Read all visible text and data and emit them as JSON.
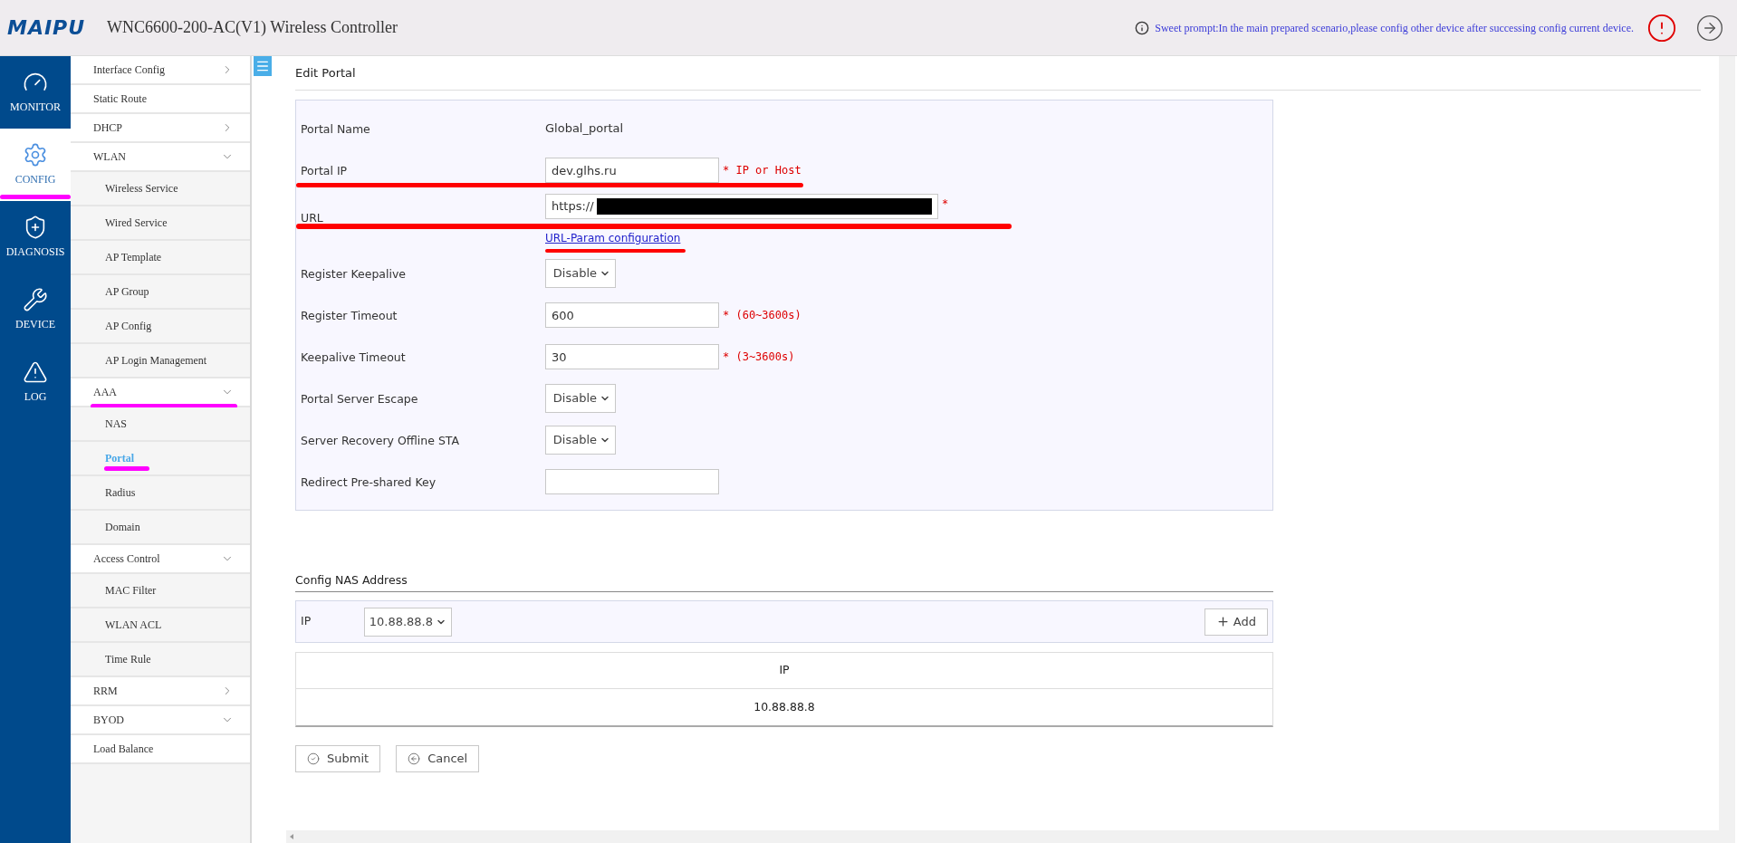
{
  "header": {
    "logo": "MAIPU",
    "title": "WNC6600-200-AC(V1) Wireless Controller",
    "prompt": "Sweet prompt:In the main prepared scenario,please config other device after successing config current device."
  },
  "nav": [
    {
      "kind": "gauge",
      "label": "MONITOR",
      "selected": false
    },
    {
      "kind": "gear",
      "label": "CONFIG",
      "selected": true
    },
    {
      "kind": "shield",
      "label": "DIAGNOSIS",
      "selected": false
    },
    {
      "kind": "wrench",
      "label": "DEVICE",
      "selected": false
    },
    {
      "kind": "alert",
      "label": "LOG",
      "selected": false
    }
  ],
  "menu": [
    {
      "label": "Interface Config",
      "expanded": false
    },
    {
      "label": "Static Route"
    },
    {
      "label": "DHCP",
      "expanded": false
    },
    {
      "label": "WLAN",
      "expanded": true,
      "children": [
        {
          "label": "Wireless Service",
          "selected": false
        },
        {
          "label": "Wired Service",
          "selected": false
        },
        {
          "label": "AP Template",
          "selected": false
        },
        {
          "label": "AP Group",
          "selected": false
        },
        {
          "label": "AP Config",
          "selected": false
        },
        {
          "label": "AP Login Management",
          "selected": false
        }
      ]
    },
    {
      "label": "AAA",
      "expanded": true,
      "children": [
        {
          "label": "NAS",
          "selected": false
        },
        {
          "label": "Portal",
          "selected": true
        },
        {
          "label": "Radius",
          "selected": false
        },
        {
          "label": "Domain",
          "selected": false
        }
      ]
    },
    {
      "label": "Access Control",
      "expanded": true,
      "children": [
        {
          "label": "MAC Filter",
          "selected": false
        },
        {
          "label": "WLAN ACL",
          "selected": false
        },
        {
          "label": "Time Rule",
          "selected": false
        }
      ]
    },
    {
      "label": "RRM",
      "expanded": false
    },
    {
      "label": "BYOD",
      "expanded": true
    },
    {
      "label": "Load Balance"
    }
  ],
  "page_title": "Edit Portal",
  "form": [
    {
      "kind": "text",
      "label": "Portal Name",
      "value": "Global_portal"
    },
    {
      "kind": "input",
      "label": "Portal IP",
      "value": "dev.glhs.ru",
      "hint": "* IP or Host"
    },
    {
      "kind": "url",
      "label": "URL",
      "value": "https://",
      "hint": "*",
      "link": "URL-Param configuration"
    },
    {
      "kind": "select",
      "label": "Register Keepalive",
      "value": "Disable"
    },
    {
      "kind": "input",
      "label": "Register Timeout",
      "value": "600",
      "hint": "* (60~3600s)"
    },
    {
      "kind": "input",
      "label": "Keepalive Timeout",
      "value": "30",
      "hint": "* (3~3600s)"
    },
    {
      "kind": "select",
      "label": "Portal Server Escape",
      "value": "Disable"
    },
    {
      "kind": "select",
      "label": "Server Recovery Offline STA",
      "value": "Disable"
    },
    {
      "kind": "input",
      "label": "Redirect Pre-shared Key"
    }
  ],
  "nas": {
    "title": "Config NAS Address",
    "ip_label": "IP",
    "ip_value": "10.88.88.8",
    "add_button": "Add",
    "table": {
      "columns": [
        "IP"
      ],
      "rows": [
        [
          "10.88.88.8"
        ]
      ]
    }
  },
  "buttons": [
    {
      "kind": "submit",
      "label": "Submit"
    },
    {
      "kind": "cancel",
      "label": "Cancel"
    }
  ]
}
